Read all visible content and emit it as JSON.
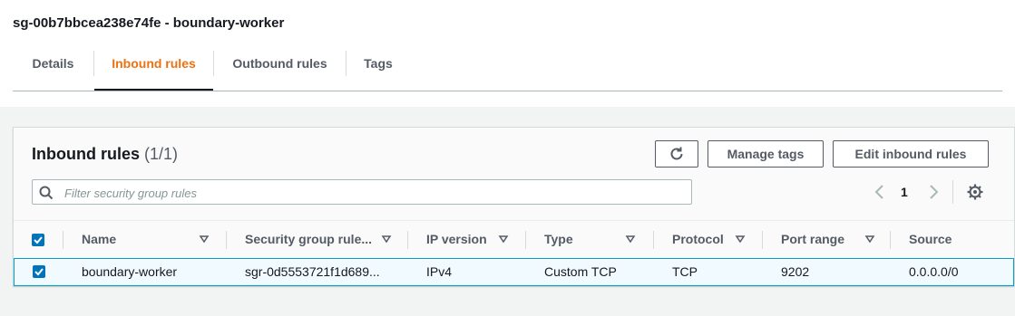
{
  "page": {
    "title": "sg-00b7bbcea238e74fe - boundary-worker"
  },
  "tabs": [
    {
      "label": "Details"
    },
    {
      "label": "Inbound rules"
    },
    {
      "label": "Outbound rules"
    },
    {
      "label": "Tags"
    }
  ],
  "active_tab": "Inbound rules",
  "panel": {
    "title": "Inbound rules",
    "count": "(1/1)",
    "buttons": {
      "refresh_icon": "refresh-icon",
      "manage_tags": "Manage tags",
      "edit_inbound": "Edit inbound rules"
    },
    "search_placeholder": "Filter security group rules",
    "search_value": "",
    "page_number": "1"
  },
  "table": {
    "columns": [
      "Name",
      "Security group rule...",
      "IP version",
      "Type",
      "Protocol",
      "Port range",
      "Source"
    ],
    "rows": [
      {
        "selected": true,
        "name": "boundary-worker",
        "rule_id": "sgr-0d5553721f1d689...",
        "ip_version": "IPv4",
        "type": "Custom TCP",
        "protocol": "TCP",
        "port_range": "9202",
        "source": "0.0.0.0/0"
      }
    ],
    "header_checkbox_checked": true
  },
  "colors": {
    "accent": "#ec7211",
    "checkbox": "#0073bb",
    "row_highlight": "#f1faff",
    "row_border": "#00a1c9"
  }
}
